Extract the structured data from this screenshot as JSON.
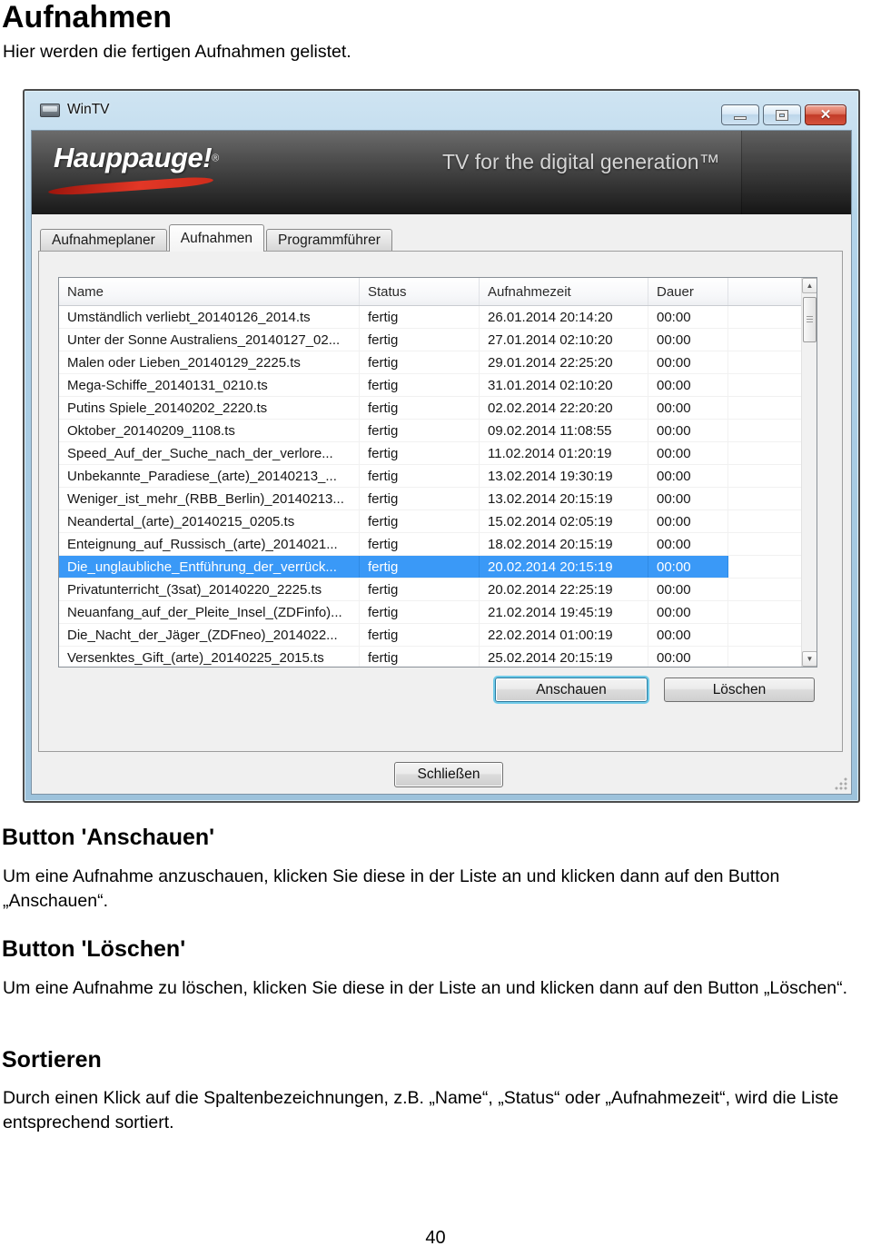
{
  "page": {
    "title": "Aufnahmen",
    "intro": "Hier werden die fertigen Aufnahmen gelistet.",
    "sections": [
      {
        "heading": "Button 'Anschauen'",
        "body": "Um eine Aufnahme anzuschauen, klicken Sie diese in der Liste an und klicken dann auf den Button „Anschauen“."
      },
      {
        "heading": "Button 'Löschen'",
        "body": "Um eine Aufnahme zu löschen, klicken Sie diese in der Liste an und klicken dann auf den Button „Löschen“."
      },
      {
        "heading": "Sortieren",
        "body": "Durch einen Klick auf die Spaltenbezeichnungen, z.B. „Name“, „Status“ oder „Aufnahmezeit“, wird die Liste entsprechend sortiert."
      }
    ],
    "page_number": "40"
  },
  "window": {
    "title": "WinTV",
    "banner": {
      "logo": "Hauppauge!",
      "logo_mark": "®",
      "tagline": "TV for the digital generation™"
    },
    "tabs": [
      {
        "label": "Aufnahmeplaner",
        "active": false
      },
      {
        "label": "Aufnahmen",
        "active": true
      },
      {
        "label": "Programmführer",
        "active": false
      }
    ],
    "table": {
      "columns": [
        "Name",
        "Status",
        "Aufnahmezeit",
        "Dauer"
      ],
      "rows": [
        {
          "name": "Umständlich verliebt_20140126_2014.ts",
          "status": "fertig",
          "time": "26.01.2014 20:14:20",
          "duration": "00:00",
          "selected": false
        },
        {
          "name": "Unter der Sonne Australiens_20140127_02...",
          "status": "fertig",
          "time": "27.01.2014 02:10:20",
          "duration": "00:00",
          "selected": false
        },
        {
          "name": "Malen oder Lieben_20140129_2225.ts",
          "status": "fertig",
          "time": "29.01.2014 22:25:20",
          "duration": "00:00",
          "selected": false
        },
        {
          "name": "Mega-Schiffe_20140131_0210.ts",
          "status": "fertig",
          "time": "31.01.2014 02:10:20",
          "duration": "00:00",
          "selected": false
        },
        {
          "name": "Putins Spiele_20140202_2220.ts",
          "status": "fertig",
          "time": "02.02.2014 22:20:20",
          "duration": "00:00",
          "selected": false
        },
        {
          "name": "Oktober_20140209_1108.ts",
          "status": "fertig",
          "time": "09.02.2014 11:08:55",
          "duration": "00:00",
          "selected": false
        },
        {
          "name": "Speed_Auf_der_Suche_nach_der_verlore...",
          "status": "fertig",
          "time": "11.02.2014 01:20:19",
          "duration": "00:00",
          "selected": false
        },
        {
          "name": "Unbekannte_Paradiese_(arte)_20140213_...",
          "status": "fertig",
          "time": "13.02.2014 19:30:19",
          "duration": "00:00",
          "selected": false
        },
        {
          "name": "Weniger_ist_mehr_(RBB_Berlin)_20140213...",
          "status": "fertig",
          "time": "13.02.2014 20:15:19",
          "duration": "00:00",
          "selected": false
        },
        {
          "name": "Neandertal_(arte)_20140215_0205.ts",
          "status": "fertig",
          "time": "15.02.2014 02:05:19",
          "duration": "00:00",
          "selected": false
        },
        {
          "name": "Enteignung_auf_Russisch_(arte)_2014021...",
          "status": "fertig",
          "time": "18.02.2014 20:15:19",
          "duration": "00:00",
          "selected": false
        },
        {
          "name": "Die_unglaubliche_Entführung_der_verrück...",
          "status": "fertig",
          "time": "20.02.2014 20:15:19",
          "duration": "00:00",
          "selected": true
        },
        {
          "name": "Privatunterricht_(3sat)_20140220_2225.ts",
          "status": "fertig",
          "time": "20.02.2014 22:25:19",
          "duration": "00:00",
          "selected": false
        },
        {
          "name": "Neuanfang_auf_der_Pleite_Insel_(ZDFinfo)...",
          "status": "fertig",
          "time": "21.02.2014 19:45:19",
          "duration": "00:00",
          "selected": false
        },
        {
          "name": "Die_Nacht_der_Jäger_(ZDFneo)_2014022...",
          "status": "fertig",
          "time": "22.02.2014 01:00:19",
          "duration": "00:00",
          "selected": false
        },
        {
          "name": "Versenktes_Gift_(arte)_20140225_2015.ts",
          "status": "fertig",
          "time": "25.02.2014 20:15:19",
          "duration": "00:00",
          "selected": false
        }
      ]
    },
    "buttons": {
      "watch": "Anschauen",
      "delete": "Löschen",
      "close": "Schließen"
    }
  },
  "colors": {
    "selection": "#3a99f7",
    "close_button_red": "#c23b28",
    "banner_swoosh_red": "#e23726",
    "aero_frame": "#b3d4ea"
  }
}
